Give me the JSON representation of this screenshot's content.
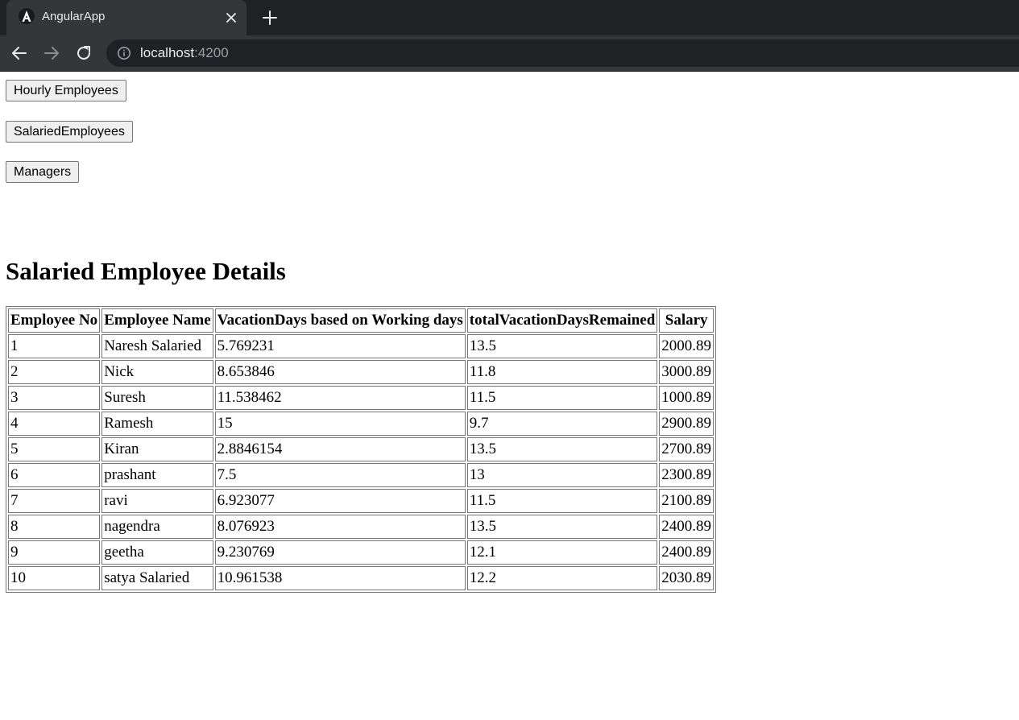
{
  "browser": {
    "tab_title": "AngularApp",
    "url_host": "localhost",
    "url_port": ":4200"
  },
  "nav_buttons": [
    {
      "label": "Hourly Employees"
    },
    {
      "label": "SalariedEmployees"
    },
    {
      "label": "Managers"
    }
  ],
  "heading": "Salaried Employee Details",
  "table": {
    "headers": [
      "Employee No",
      "Employee Name",
      "VacationDays based on Working days",
      "totalVacationDaysRemained",
      "Salary"
    ],
    "rows": [
      [
        "1",
        "Naresh Salaried",
        "5.769231",
        "13.5",
        "2000.89"
      ],
      [
        "2",
        "Nick",
        "8.653846",
        "11.8",
        "3000.89"
      ],
      [
        "3",
        "Suresh",
        "11.538462",
        "11.5",
        "1000.89"
      ],
      [
        "4",
        "Ramesh",
        "15",
        "9.7",
        "2900.89"
      ],
      [
        "5",
        "Kiran",
        "2.8846154",
        "13.5",
        "2700.89"
      ],
      [
        "6",
        "prashant",
        "7.5",
        "13",
        "2300.89"
      ],
      [
        "7",
        "ravi",
        "6.923077",
        "11.5",
        "2100.89"
      ],
      [
        "8",
        "nagendra",
        "8.076923",
        "13.5",
        "2400.89"
      ],
      [
        "9",
        "geetha",
        "9.230769",
        "12.1",
        "2400.89"
      ],
      [
        "10",
        "satya Salaried",
        "10.961538",
        "12.2",
        "2030.89"
      ]
    ]
  }
}
